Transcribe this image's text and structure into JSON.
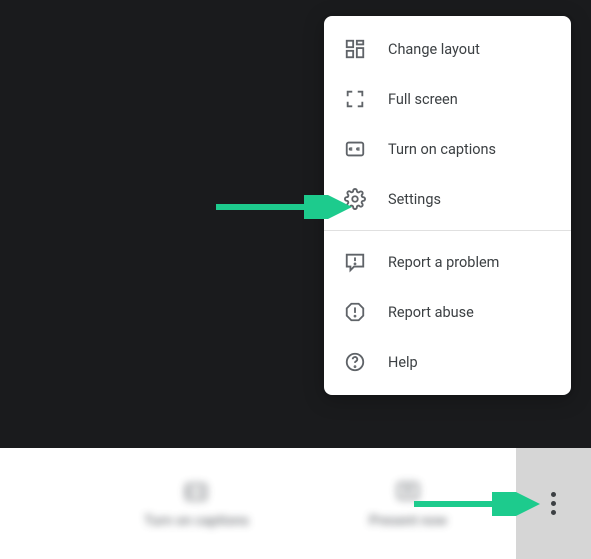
{
  "menu": {
    "items": [
      {
        "label": "Change layout"
      },
      {
        "label": "Full screen"
      },
      {
        "label": "Turn on captions"
      },
      {
        "label": "Settings"
      }
    ],
    "items2": [
      {
        "label": "Report a problem"
      },
      {
        "label": "Report abuse"
      },
      {
        "label": "Help"
      }
    ]
  },
  "bottom": {
    "captions": "Turn on captions",
    "present": "Present now"
  },
  "colors": {
    "arrow": "#1dcb8d"
  }
}
